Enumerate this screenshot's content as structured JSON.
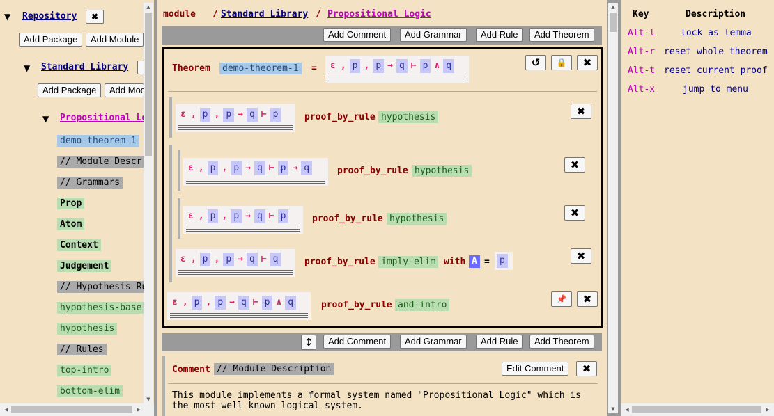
{
  "left": {
    "repository": "Repository",
    "close_symbol": "✖",
    "add_package": "Add Package",
    "add_module": "Add Module",
    "add_module_trunc": "Add Mod",
    "standard_library": "Standard Library",
    "propositional_logic": "Propositional Lo",
    "items": [
      "demo-theorem-1",
      "// Module Descr",
      "// Grammars",
      "Prop",
      "Atom",
      "Context",
      "Judgement",
      "// Hypothesis Ru",
      "hypothesis-base",
      "hypothesis",
      "// Rules",
      "top-intro",
      "bottom-elim"
    ]
  },
  "middle": {
    "breadcrumb_module": "module",
    "breadcrumb_sep": "/",
    "breadcrumb_stdlib": "Standard Library",
    "breadcrumb_prop": "Propositional Logic",
    "add_comment": "Add Comment",
    "add_grammar": "Add Grammar",
    "add_rule": "Add Rule",
    "add_theorem": "Add Theorem",
    "theorem_kw": "Theorem",
    "theorem_name": "demo-theorem-1",
    "equals": "=",
    "proof_by_rule": "proof_by_rule",
    "with_kw": "with",
    "rule_hypothesis": "hypothesis",
    "rule_imply_elim": "imply-elim",
    "rule_and_intro": "and-intro",
    "subst_var": "A",
    "subst_val": "p",
    "comment_kw": "Comment",
    "comment_title": "// Module Description",
    "edit_comment": "Edit Comment",
    "comment_line1": "This module implements a formal system named \"Propositional Logic\" which is",
    "comment_line2": "the most well known logical system.",
    "sym": {
      "eps": "ε",
      "comma": ",",
      "arrow": "→",
      "turnstile": "⊢",
      "and": "∧",
      "p": "p",
      "q": "q"
    }
  },
  "right": {
    "key_header": "Key",
    "desc_header": "Description",
    "rows": [
      {
        "key": "Alt-l",
        "desc": "lock as lemma"
      },
      {
        "key": "Alt-r",
        "desc": "reset whole theorem"
      },
      {
        "key": "Alt-t",
        "desc": "reset current proof"
      },
      {
        "key": "Alt-x",
        "desc": "jump to menu"
      }
    ]
  },
  "icons": {
    "close": "✖",
    "undo": "↺",
    "lock": "🔒",
    "pin": "📌",
    "resize": "↕",
    "tri_down": "▼",
    "tri_up": "▲",
    "tri_left": "◀",
    "tri_right": "▶"
  }
}
